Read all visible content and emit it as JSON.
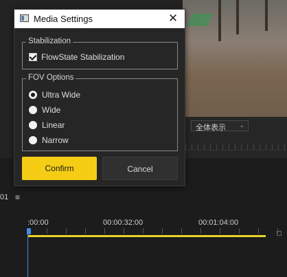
{
  "background": {
    "zoom_select": {
      "value": "全体表示"
    },
    "timeline": {
      "timecode_partial": "01",
      "ruler_labels": [
        ":00:00",
        "00:00:32:00",
        "00:01:04:00"
      ]
    }
  },
  "dialog": {
    "title": "Media Settings",
    "close_glyph": "✕",
    "stabilization": {
      "legend": "Stabilization",
      "checkbox": {
        "label": "FlowState Stabilization",
        "checked": true
      }
    },
    "fov": {
      "legend": "FOV Options",
      "options": [
        {
          "label": "Ultra Wide",
          "selected": true
        },
        {
          "label": "Wide",
          "selected": false
        },
        {
          "label": "Linear",
          "selected": false
        },
        {
          "label": "Narrow",
          "selected": false
        }
      ]
    },
    "buttons": {
      "confirm": "Confirm",
      "cancel": "Cancel"
    }
  },
  "colors": {
    "accent": "#f4cd14",
    "playhead": "#3d8ee6",
    "clip_bar": "#e8d52a"
  }
}
